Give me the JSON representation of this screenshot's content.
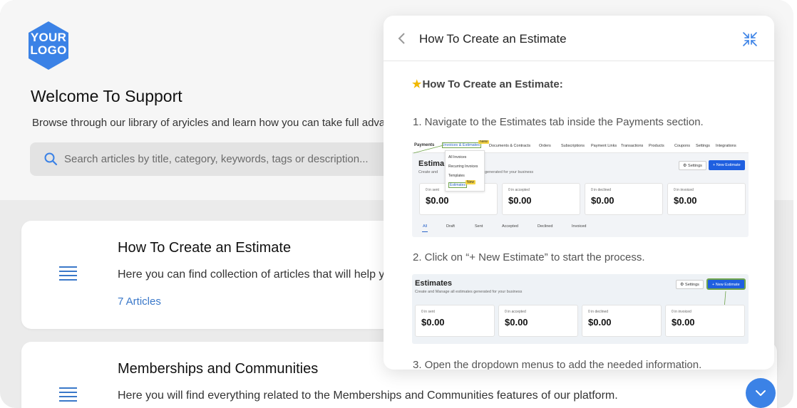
{
  "brand": {
    "logo_line1": "YOUR",
    "logo_line2": "LOGO",
    "accent": "#3b82e6",
    "link": "#3a78c9"
  },
  "hero": {
    "title": "Welcome To Support",
    "subtitle": "Browse through our library of aryicles and learn how you can take full advar",
    "search_placeholder": "Search articles by title, category, keywords, tags or description..."
  },
  "categories": [
    {
      "icon": "list-icon",
      "title": "How To Create an Estimate",
      "description": "Here you can find collection of articles that will help y",
      "count": "7 Articles"
    },
    {
      "icon": "list-icon",
      "title": "Memberships and Communities",
      "description": "Here you will find everything related to the Memberships and Communities features of our platform."
    }
  ],
  "panel": {
    "title": "How To Create an Estimate",
    "heading": "How To Create an Estimate:",
    "steps": [
      "1. Navigate to the Estimates tab inside the Payments section.",
      "2. Click on “+ New Estimate” to start the process.",
      "3. Open the dropdown menus to add the needed information."
    ]
  },
  "shot1": {
    "nav": [
      "Payments",
      "Invoices & Estimates",
      "Documents & Contracts",
      "Orders",
      "Subscriptions",
      "Payment Links",
      "Transactions",
      "Products",
      "Coupons",
      "Settings",
      "Integrations"
    ],
    "badge": "New",
    "dropdown": [
      "All Invoices",
      "Recurring Invoices",
      "Templates",
      "Estimates"
    ],
    "title": "Estima",
    "sub_left": "Create and",
    "sub_right": "generated for your business",
    "settings": "Settings",
    "new": "+ New Estimate",
    "stats": [
      {
        "label": "0 in sent",
        "amount": "$0.00"
      },
      {
        "label": "0 in accepted",
        "amount": "$0.00"
      },
      {
        "label": "0 in declined",
        "amount": "$0.00"
      },
      {
        "label": "0 in invoiced",
        "amount": "$0.00"
      }
    ],
    "tabs": [
      "All",
      "Draft",
      "Sent",
      "Accepted",
      "Declined",
      "Invoiced"
    ]
  },
  "shot2": {
    "title": "Estimates",
    "sub": "Create and Manage all estimates generated for your business",
    "settings": "Settings",
    "new": "+ New Estimate",
    "stats": [
      {
        "label": "0 in sent",
        "amount": "$0.00"
      },
      {
        "label": "0 in accepted",
        "amount": "$0.00"
      },
      {
        "label": "0 in declined",
        "amount": "$0.00"
      },
      {
        "label": "0 in invoiced",
        "amount": "$0.00"
      }
    ]
  }
}
